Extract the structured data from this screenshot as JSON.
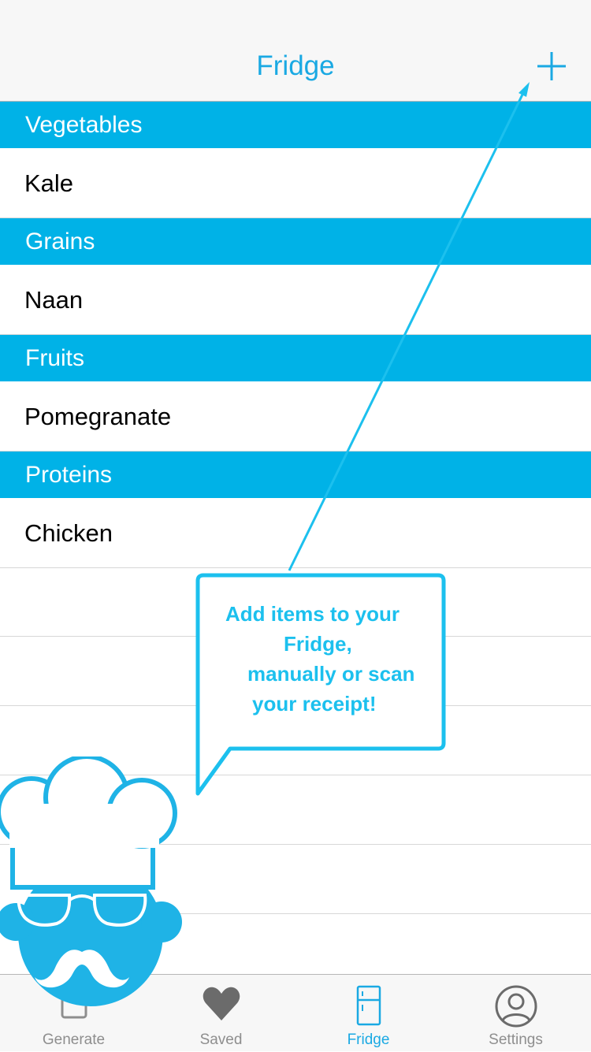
{
  "nav": {
    "title": "Fridge",
    "add_icon": "plus-icon"
  },
  "sections": [
    {
      "header": "Vegetables",
      "items": [
        "Kale"
      ]
    },
    {
      "header": "Grains",
      "items": [
        "Naan"
      ]
    },
    {
      "header": "Fruits",
      "items": [
        "Pomegranate"
      ]
    },
    {
      "header": "Proteins",
      "items": [
        "Chicken"
      ]
    }
  ],
  "tooltip": {
    "lines": [
      "Add items to your",
      "Fridge,",
      "manually or scan",
      "your receipt!"
    ]
  },
  "tabs": [
    {
      "label": "Generate",
      "icon": "generate-icon",
      "active": false
    },
    {
      "label": "Saved",
      "icon": "heart-icon",
      "active": false
    },
    {
      "label": "Fridge",
      "icon": "fridge-icon",
      "active": true
    },
    {
      "label": "Settings",
      "icon": "user-icon",
      "active": false
    }
  ],
  "colors": {
    "accent": "#00b2e7",
    "title": "#1aa9e3",
    "tooltip": "#1cc0ee"
  }
}
